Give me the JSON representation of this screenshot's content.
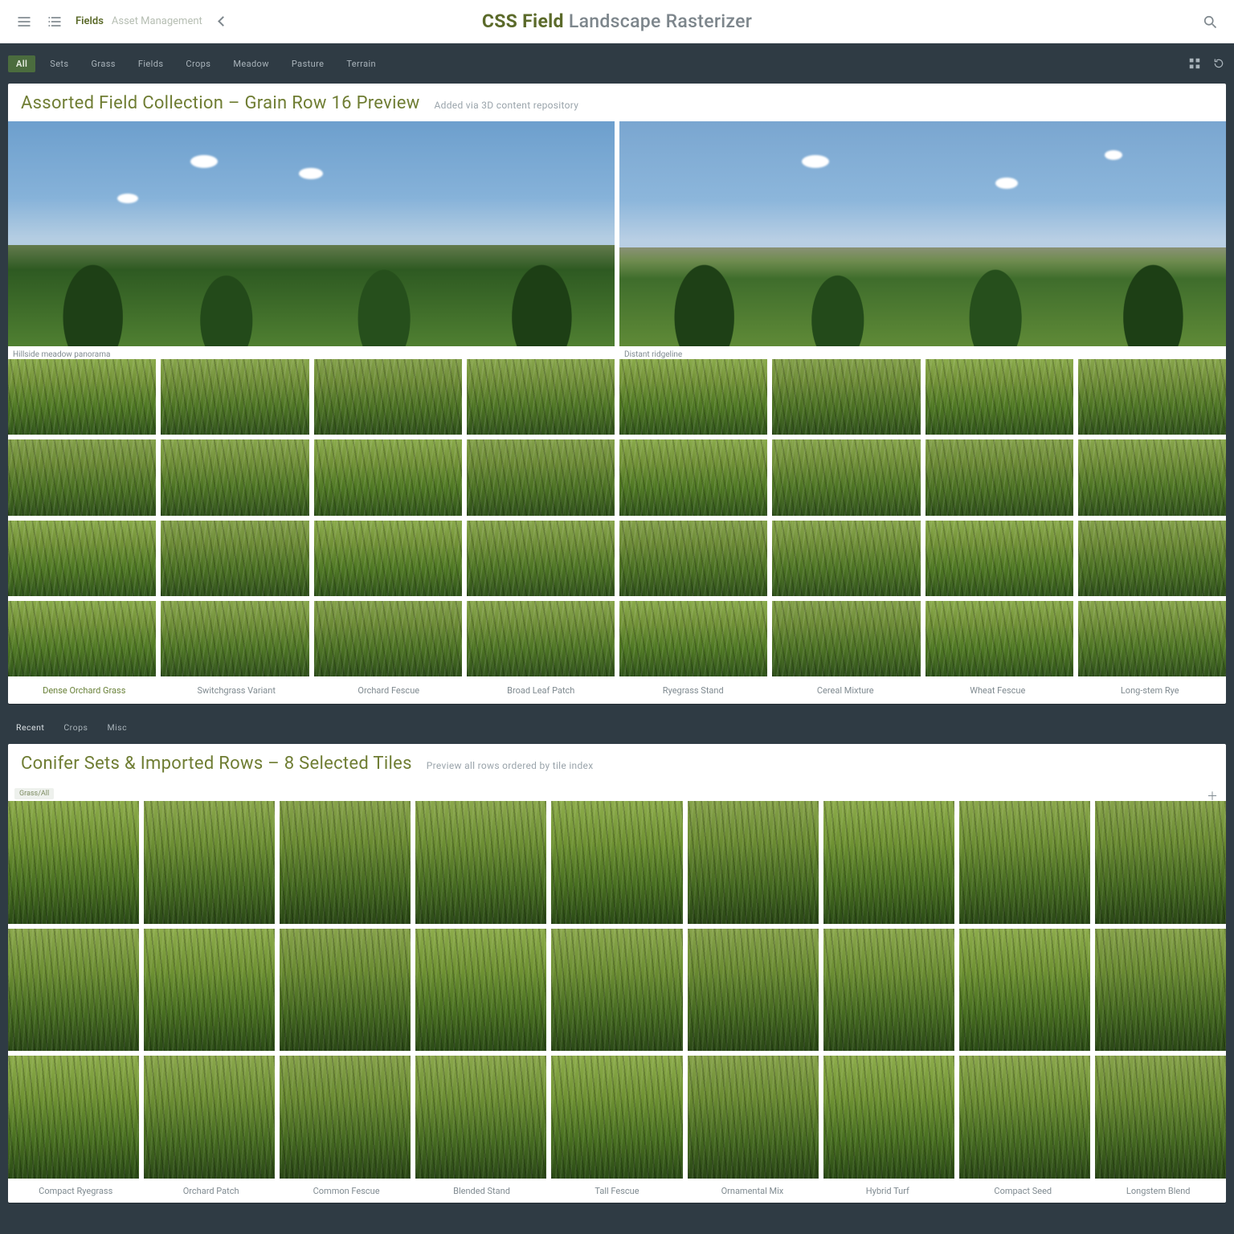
{
  "header": {
    "brand_primary": "Fields",
    "brand_secondary": "Asset Management",
    "title_strong": "CSS Field",
    "title_rest": "Landscape Rasterizer"
  },
  "section1": {
    "tabs": [
      "All",
      "Sets",
      "Grass",
      "Fields",
      "Crops",
      "Meadow",
      "Pasture",
      "Terrain"
    ],
    "active_tab_index": 0,
    "title": "Assorted Field Collection – Grain Row 16 Preview",
    "subtitle": "Added via 3D content repository",
    "pano_labels": [
      "Hillside meadow panorama",
      "Distant ridgeline"
    ],
    "grass_labels": [
      "Dense Orchard Grass",
      "Switchgrass Variant",
      "Orchard Fescue",
      "Broad Leaf Patch",
      "Ryegrass Stand",
      "Cereal Mixture",
      "Wheat Fescue",
      "Long-stem Rye"
    ]
  },
  "section2": {
    "tabs": [
      "Recent",
      "Crops",
      "Misc"
    ],
    "active_tab_index": 0,
    "title": "Conifer Sets & Imported Rows – 8 Selected Tiles",
    "subtitle": "Preview all rows ordered by tile index",
    "corner_badge": "Grass/All",
    "grass_labels": [
      "Compact Ryegrass",
      "Orchard Patch",
      "Common Fescue",
      "Blended Stand",
      "Tall Fescue",
      "Ornamental Mix",
      "Hybrid Turf",
      "Compact Seed",
      "Longstem Blend"
    ]
  }
}
